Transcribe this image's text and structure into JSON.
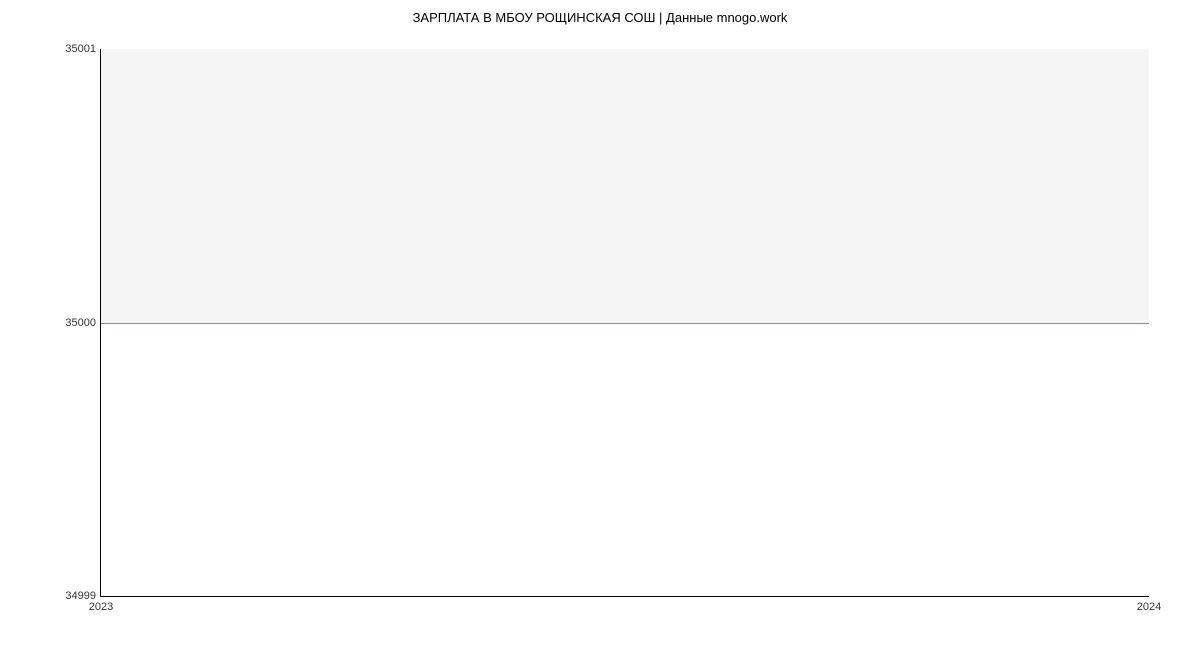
{
  "chart_data": {
    "type": "line",
    "title": "ЗАРПЛАТА В МБОУ РОЩИНСКАЯ СОШ | Данные mnogo.work",
    "x": [
      "2023",
      "2024"
    ],
    "values": [
      35000,
      35000
    ],
    "xlabel": "",
    "ylabel": "",
    "ylim": [
      34999,
      35001
    ],
    "y_ticks": [
      "34999",
      "35000",
      "35001"
    ],
    "x_ticks": [
      "2023",
      "2024"
    ],
    "line_color": "#5a9bd5"
  }
}
